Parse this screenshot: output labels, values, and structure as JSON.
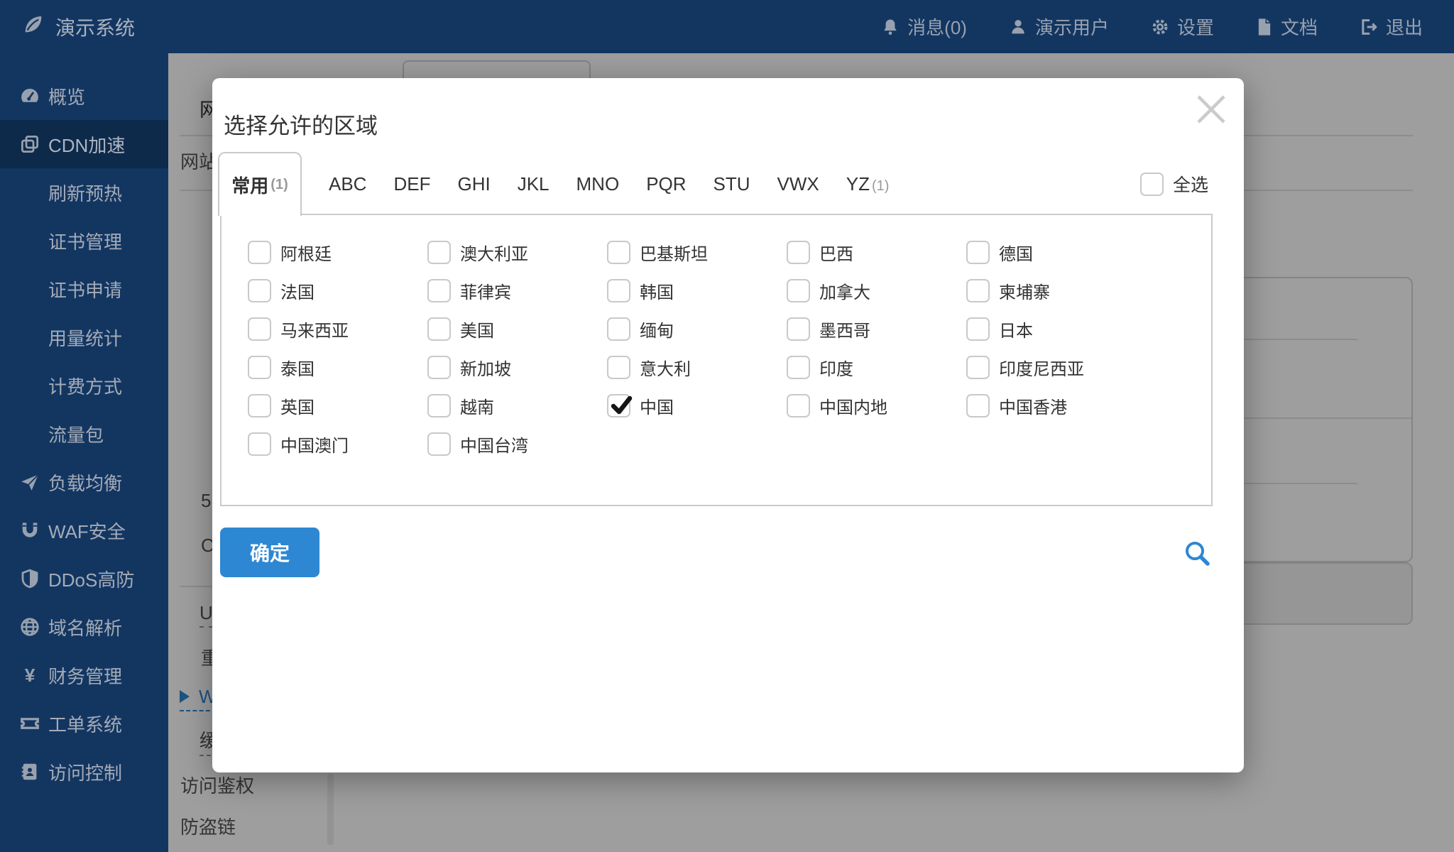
{
  "app": {
    "logo_label": "演示系统",
    "logo_icon": "leaf-icon"
  },
  "navbar": {
    "items": [
      {
        "label": "消息(0)",
        "icon": "bell-icon"
      },
      {
        "label": "演示用户",
        "icon": "user-icon"
      },
      {
        "label": "设置",
        "icon": "gear-icon"
      },
      {
        "label": "文档",
        "icon": "document-icon"
      },
      {
        "label": "退出",
        "icon": "logout-icon"
      }
    ]
  },
  "sidebar": {
    "items": [
      {
        "label": "概览",
        "icon": "gauge-icon"
      },
      {
        "label": "CDN加速",
        "icon": "copy-icon",
        "active": true
      },
      {
        "label": "刷新预热",
        "sub": true
      },
      {
        "label": "证书管理",
        "sub": true
      },
      {
        "label": "证书申请",
        "sub": true
      },
      {
        "label": "用量统计",
        "sub": true
      },
      {
        "label": "计费方式",
        "sub": true
      },
      {
        "label": "流量包",
        "sub": true
      },
      {
        "label": "负载均衡",
        "icon": "paper-plane-icon"
      },
      {
        "label": "WAF安全",
        "icon": "magnet-icon"
      },
      {
        "label": "DDoS高防",
        "icon": "shield-icon"
      },
      {
        "label": "域名解析",
        "icon": "globe-icon"
      },
      {
        "label": "财务管理",
        "icon": "yen-icon"
      },
      {
        "label": "工单系统",
        "icon": "ticket-icon"
      },
      {
        "label": "访问控制",
        "icon": "address-card-icon"
      }
    ]
  },
  "background_page": {
    "visible_fragments": [
      {
        "text": "网",
        "kind": "heading"
      },
      {
        "text": "网站",
        "kind": "item"
      },
      {
        "text": "5",
        "kind": "item"
      },
      {
        "text": "C",
        "kind": "item"
      },
      {
        "text": "U",
        "kind": "dashed"
      },
      {
        "text": "重",
        "kind": "item"
      },
      {
        "text": "W",
        "kind": "link"
      },
      {
        "text": "缓",
        "kind": "dashed"
      },
      {
        "text": "访问鉴权",
        "kind": "item"
      },
      {
        "text": "防盗链",
        "kind": "item"
      }
    ]
  },
  "modal": {
    "title": "选择允许的区域",
    "close_icon": "close-icon",
    "tabs": [
      {
        "label": "常用",
        "count": "(1)",
        "active": true
      },
      {
        "label": "ABC"
      },
      {
        "label": "DEF"
      },
      {
        "label": "GHI"
      },
      {
        "label": "JKL"
      },
      {
        "label": "MNO"
      },
      {
        "label": "PQR"
      },
      {
        "label": "STU"
      },
      {
        "label": "VWX"
      },
      {
        "label": "YZ",
        "count": "(1)"
      }
    ],
    "select_all": {
      "label": "全选",
      "checked": false
    },
    "regions": [
      {
        "label": "阿根廷",
        "checked": false
      },
      {
        "label": "澳大利亚",
        "checked": false
      },
      {
        "label": "巴基斯坦",
        "checked": false
      },
      {
        "label": "巴西",
        "checked": false
      },
      {
        "label": "德国",
        "checked": false
      },
      {
        "label": "法国",
        "checked": false
      },
      {
        "label": "菲律宾",
        "checked": false
      },
      {
        "label": "韩国",
        "checked": false
      },
      {
        "label": "加拿大",
        "checked": false
      },
      {
        "label": "柬埔寨",
        "checked": false
      },
      {
        "label": "马来西亚",
        "checked": false
      },
      {
        "label": "美国",
        "checked": false
      },
      {
        "label": "缅甸",
        "checked": false
      },
      {
        "label": "墨西哥",
        "checked": false
      },
      {
        "label": "日本",
        "checked": false
      },
      {
        "label": "泰国",
        "checked": false
      },
      {
        "label": "新加坡",
        "checked": false
      },
      {
        "label": "意大利",
        "checked": false
      },
      {
        "label": "印度",
        "checked": false
      },
      {
        "label": "印度尼西亚",
        "checked": false
      },
      {
        "label": "英国",
        "checked": false
      },
      {
        "label": "越南",
        "checked": false
      },
      {
        "label": "中国",
        "checked": true
      },
      {
        "label": "中国内地",
        "checked": false
      },
      {
        "label": "中国香港",
        "checked": false
      },
      {
        "label": "中国澳门",
        "checked": false
      },
      {
        "label": "中国台湾",
        "checked": false
      }
    ],
    "confirm_label": "确定",
    "search_icon": "search-icon"
  },
  "colors": {
    "navbar_bg": "#133661",
    "sidebar_active_bg": "#0d2a4b",
    "accent_blue": "#2e87d2",
    "checkmark": "#151515",
    "close_gray": "#cbcbcb"
  }
}
